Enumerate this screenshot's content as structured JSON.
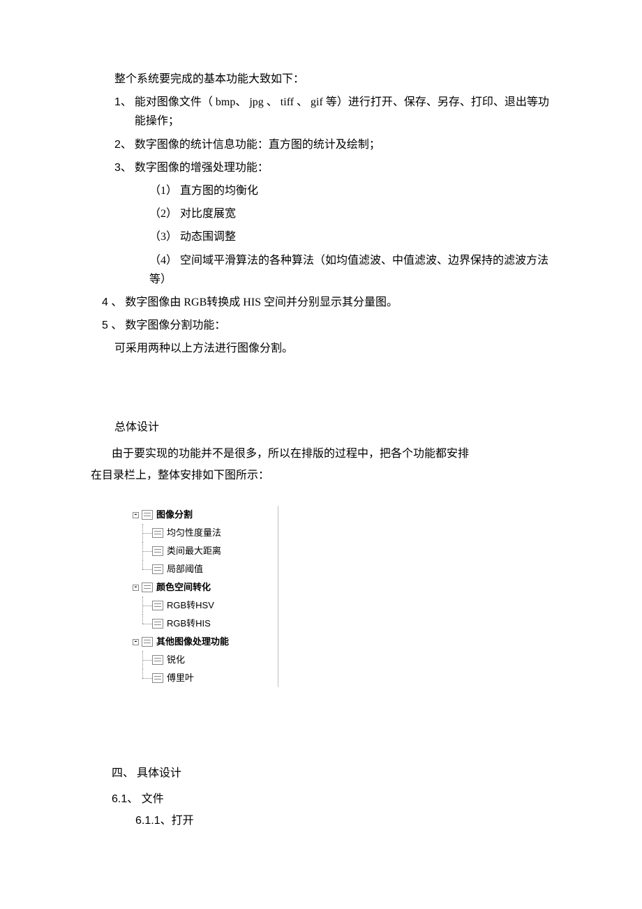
{
  "intro": "整个系统要完成的基本功能大致如下：",
  "items": [
    {
      "num": "1、",
      "text": "能对图像文件（ bmp、 jpg 、 tiff   、 gif   等）进行打开、保存、另存、打印、退出等功能操作；"
    },
    {
      "num": "2、",
      "text": "数字图像的统计信息功能：直方图的统计及绘制；"
    },
    {
      "num": "3、",
      "text": "数字图像的增强处理功能："
    }
  ],
  "subitems": [
    {
      "num": "（1）",
      "text": " 直方图的均衡化"
    },
    {
      "num": "（2）",
      "text": " 对比度展宽"
    },
    {
      "num": "（3）",
      "text": " 动态围调整"
    },
    {
      "num": "（4）",
      "text": " 空间域平滑算法的各种算法（如均值滤波、中值滤波、边界保持的滤波方法等）"
    }
  ],
  "items2": [
    {
      "num": "4  、",
      "text": "数字图像由  RGB转换成  HIS 空间并分别显示其分量图。"
    },
    {
      "num": "5  、",
      "text": "数字图像分割功能："
    }
  ],
  "after5": "可采用两种以上方法进行图像分割。",
  "overall_title": "总体设计",
  "overall_p1": "由于要实现的功能并不是很多，所以在排版的过程中，把各个功能都安排",
  "overall_p2": "在目录栏上，整体安排如下图所示：",
  "tree": {
    "n1": "图像分割",
    "n1c": [
      "均匀性度量法",
      "类间最大距离",
      "局部阈值"
    ],
    "n2": "颜色空间转化",
    "n2c": [
      "RGB转HSV",
      "RGB转HIS"
    ],
    "n3": "其他图像处理功能",
    "n3c": [
      "锐化",
      "傅里叶"
    ]
  },
  "sec4": "四、  具体设计",
  "sec61": "6.1、  文件",
  "sec611": "6.1.1、打开"
}
